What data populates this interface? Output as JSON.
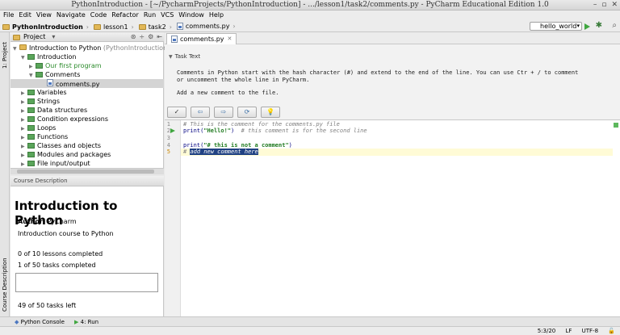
{
  "window": {
    "title": "PythonIntroduction - [~/PycharmProjects/PythonIntroduction] - .../lesson1/task2/comments.py - PyCharm Educational Edition 1.0"
  },
  "menu": [
    "File",
    "Edit",
    "View",
    "Navigate",
    "Code",
    "Refactor",
    "Run",
    "VCS",
    "Window",
    "Help"
  ],
  "breadcrumbs": [
    "PythonIntroduction",
    "lesson1",
    "task2",
    "comments.py"
  ],
  "run_config": {
    "label": "hello_world"
  },
  "side_tabs": {
    "project": "1: Project",
    "course": "Course Description"
  },
  "project_panel": {
    "title": "Project",
    "tree": [
      {
        "label": "Introduction to Python",
        "extra": "(PythonIntroduction)"
      },
      {
        "label": "Introduction"
      },
      {
        "label": "Our first program"
      },
      {
        "label": "Comments"
      },
      {
        "label": "comments.py"
      },
      {
        "label": "Variables"
      },
      {
        "label": "Strings"
      },
      {
        "label": "Data structures"
      },
      {
        "label": "Condition expressions"
      },
      {
        "label": "Loops"
      },
      {
        "label": "Functions"
      },
      {
        "label": "Classes and objects"
      },
      {
        "label": "Modules and packages"
      },
      {
        "label": "File input/output"
      }
    ]
  },
  "course": {
    "header": "Course Description",
    "title": "Introduction to Python",
    "author_label": "Author:",
    "author": "PyCharm",
    "description": "Introduction course to Python",
    "lessons_completed": "0 of 10 lessons completed",
    "tasks_completed": "1 of 50 tasks completed",
    "tasks_left": "49 of 50 tasks left"
  },
  "editor": {
    "tab": "comments.py",
    "task_label": "Task Text",
    "task_lines": [
      "Comments in Python start with the hash character (#) and extend to the end of the line. You can use Ctr + / to comment",
      "or uncomment the whole line in PyCharm.",
      "Add a new comment to the file."
    ],
    "task_buttons": [
      "✓",
      "⇦",
      "⇨",
      "⟳",
      "💡"
    ],
    "line_numbers": [
      "1",
      "2",
      "3",
      "4",
      "5"
    ],
    "code": {
      "line1": "# This is the comment for the comments.py file",
      "line2_fn": "print(",
      "line2_str": "\"Hello!\"",
      "line2_close": ")",
      "line2_cmt": "# this comment is for the second line",
      "line4_fn": "print(",
      "line4_str": "\"# this is not a comment\"",
      "line4_close": ")",
      "line5_hash": "# ",
      "line5_sel": "add new comment here"
    }
  },
  "tool_windows": {
    "console": "Python Console",
    "run": "4: Run"
  },
  "status": {
    "position": "5:3/20",
    "line_sep": "LF",
    "encoding": "UTF-8"
  },
  "colors": {
    "accent_green": "#3fa63f",
    "selection": "#214283",
    "current_line": "#fffbd6"
  }
}
